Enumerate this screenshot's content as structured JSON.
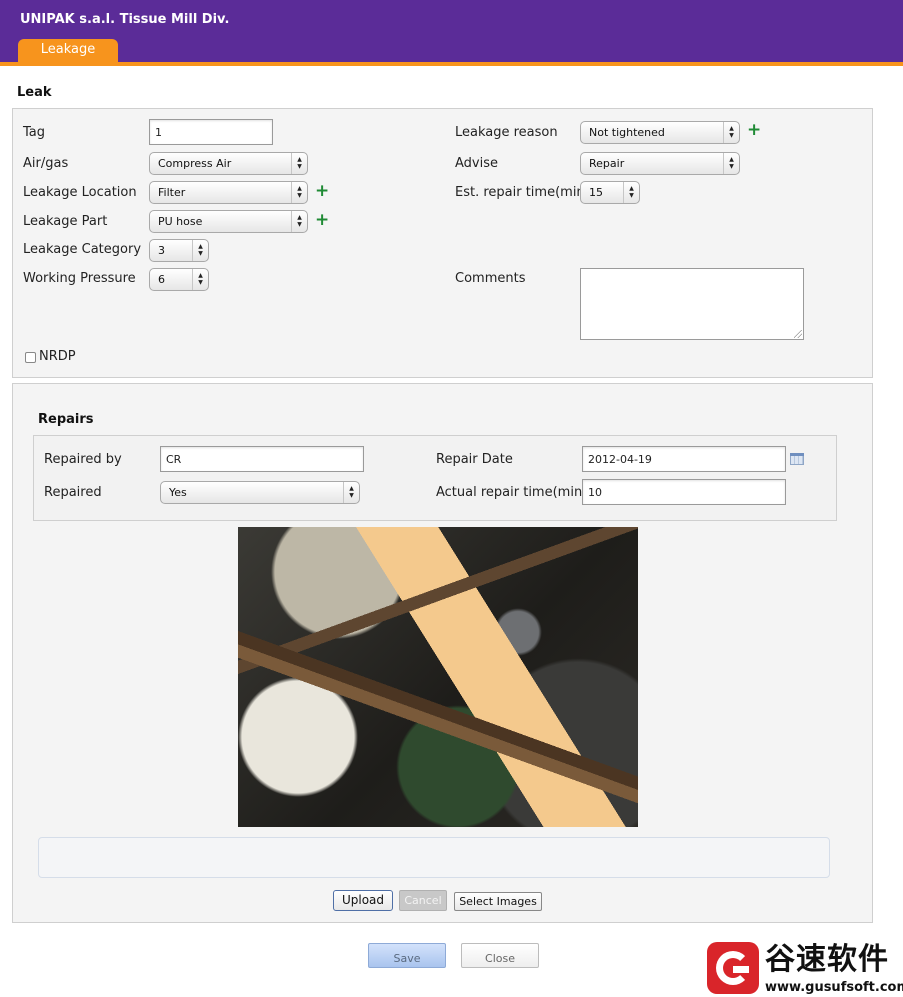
{
  "app": {
    "title": "UNIPAK s.a.l. Tissue Mill Div."
  },
  "tabs": [
    {
      "label": "Leakage"
    }
  ],
  "leak": {
    "section_title": "Leak",
    "tag": {
      "label": "Tag",
      "value": "1"
    },
    "air_gas": {
      "label": "Air/gas",
      "value": "Compress Air"
    },
    "leakage_location": {
      "label": "Leakage Location",
      "value": "Filter"
    },
    "leakage_part": {
      "label": "Leakage Part",
      "value": "PU hose"
    },
    "leakage_category": {
      "label": "Leakage Category",
      "value": "3"
    },
    "working_pressure": {
      "label": "Working Pressure",
      "value": "6"
    },
    "leakage_reason": {
      "label": "Leakage reason",
      "value": "Not tightened"
    },
    "advise": {
      "label": "Advise",
      "value": "Repair"
    },
    "est_repair_time": {
      "label": "Est. repair time(min)",
      "value": "15"
    },
    "comments": {
      "label": "Comments",
      "value": ""
    },
    "nrdp": {
      "label": "NRDP",
      "checked": false
    }
  },
  "repairs": {
    "section_title": "Repairs",
    "repaired_by": {
      "label": "Repaired by",
      "value": "CR"
    },
    "repaired": {
      "label": "Repaired",
      "value": "Yes"
    },
    "repair_date": {
      "label": "Repair Date",
      "value": "2012-04-19"
    },
    "actual_repair_time": {
      "label": "Actual repair time(min)",
      "value": "10"
    }
  },
  "upload": {
    "upload_label": "Upload",
    "cancel_label": "Cancel",
    "select_images_label": "Select Images"
  },
  "footer": {
    "save_label": "Save",
    "close_label": "Close"
  },
  "watermark": {
    "name": "谷速软件",
    "url": "www.gusufsoft.com"
  },
  "icons": {
    "plus": "plus-icon",
    "select_arrows": "select-arrows-icon",
    "calendar": "calendar-icon"
  },
  "colors": {
    "header": "#5b2c98",
    "accent": "#f7941d",
    "plus": "#1f8a35",
    "brand_red": "#d9252a"
  }
}
